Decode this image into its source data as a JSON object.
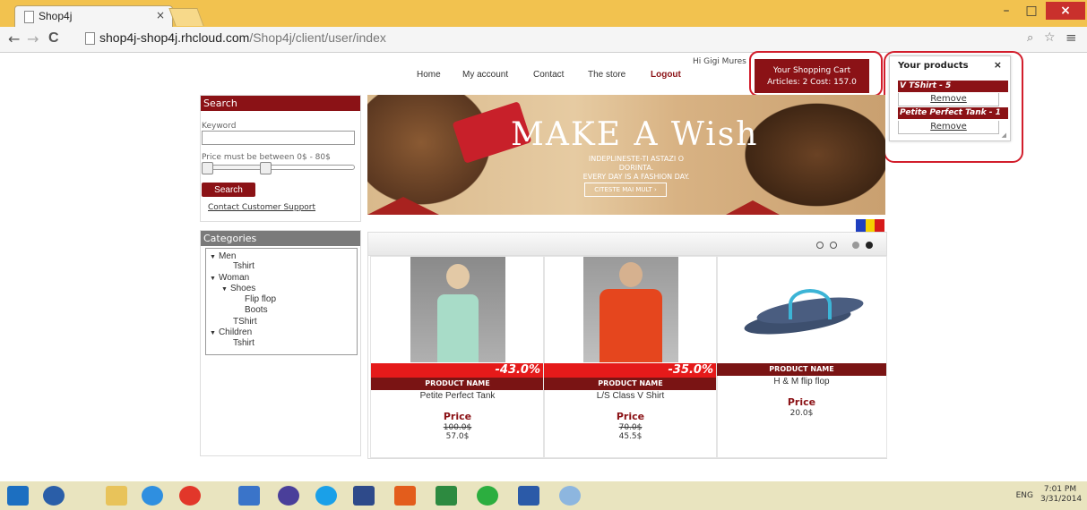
{
  "browser": {
    "tab_title": "Shop4j",
    "tab_close": "×",
    "back": "←",
    "forward": "→",
    "reload": "C",
    "url_host": "shop4j-shop4j.rhcloud.com",
    "url_path": "/Shop4j/client/user/index",
    "minimize": "–",
    "maximize": "□",
    "close": "×"
  },
  "header": {
    "nav": [
      "Home",
      "My account",
      "Contact",
      "The store",
      "Logout"
    ],
    "greeting": "Hi Gigi Mures"
  },
  "cart": {
    "title": "Your Shopping Cart",
    "summary": "Articles: 2   Cost: 157.0"
  },
  "products_panel": {
    "title": "Your products",
    "close": "×",
    "items": [
      {
        "name": "V TShirt - 5",
        "remove": "Remove"
      },
      {
        "name": "Petite Perfect Tank - 1",
        "remove": "Remove"
      }
    ]
  },
  "search": {
    "title": "Search",
    "keyword_label": "Keyword",
    "keyword_value": "",
    "price_label": "Price must be between 0$ - 80$",
    "range_min": 0,
    "range_max": 80,
    "button": "Search",
    "support_link": "Contact Customer Support"
  },
  "categories": {
    "title": "Categories",
    "tree": [
      "Men",
      "Tshirt",
      "Woman",
      "Shoes",
      "Flip flop",
      "Boots",
      "TShirt",
      "Children",
      "Tshirt"
    ]
  },
  "banner": {
    "headline": "MAKE A Wish",
    "line1": "INDEPLINESTE-TI ASTAZI O DORINTA.",
    "line2": "EVERY DAY IS A FASHION DAY.",
    "cta": "CITESTE MAI MULT ›"
  },
  "products": [
    {
      "discount": "-43.0%",
      "label": "PRODUCT NAME",
      "name": "Petite Perfect Tank",
      "price_label": "Price",
      "old_price": "100.0$",
      "price": "57.0$"
    },
    {
      "discount": "-35.0%",
      "label": "PRODUCT NAME",
      "name": "L/S Class V Shirt",
      "price_label": "Price",
      "old_price": "70.0$",
      "price": "45.5$"
    },
    {
      "discount": "",
      "label": "PRODUCT NAME",
      "name": "H & M flip flop",
      "price_label": "Price",
      "old_price": "",
      "price": "20.0$"
    }
  ],
  "taskbar": {
    "lang": "ENG",
    "time": "7:01 PM",
    "date": "3/31/2014"
  },
  "colors": {
    "brand_red": "#8b1216",
    "discount_red": "#e51a1a",
    "highlight": "#d21e2c",
    "tab_bar": "#f2c24f"
  }
}
